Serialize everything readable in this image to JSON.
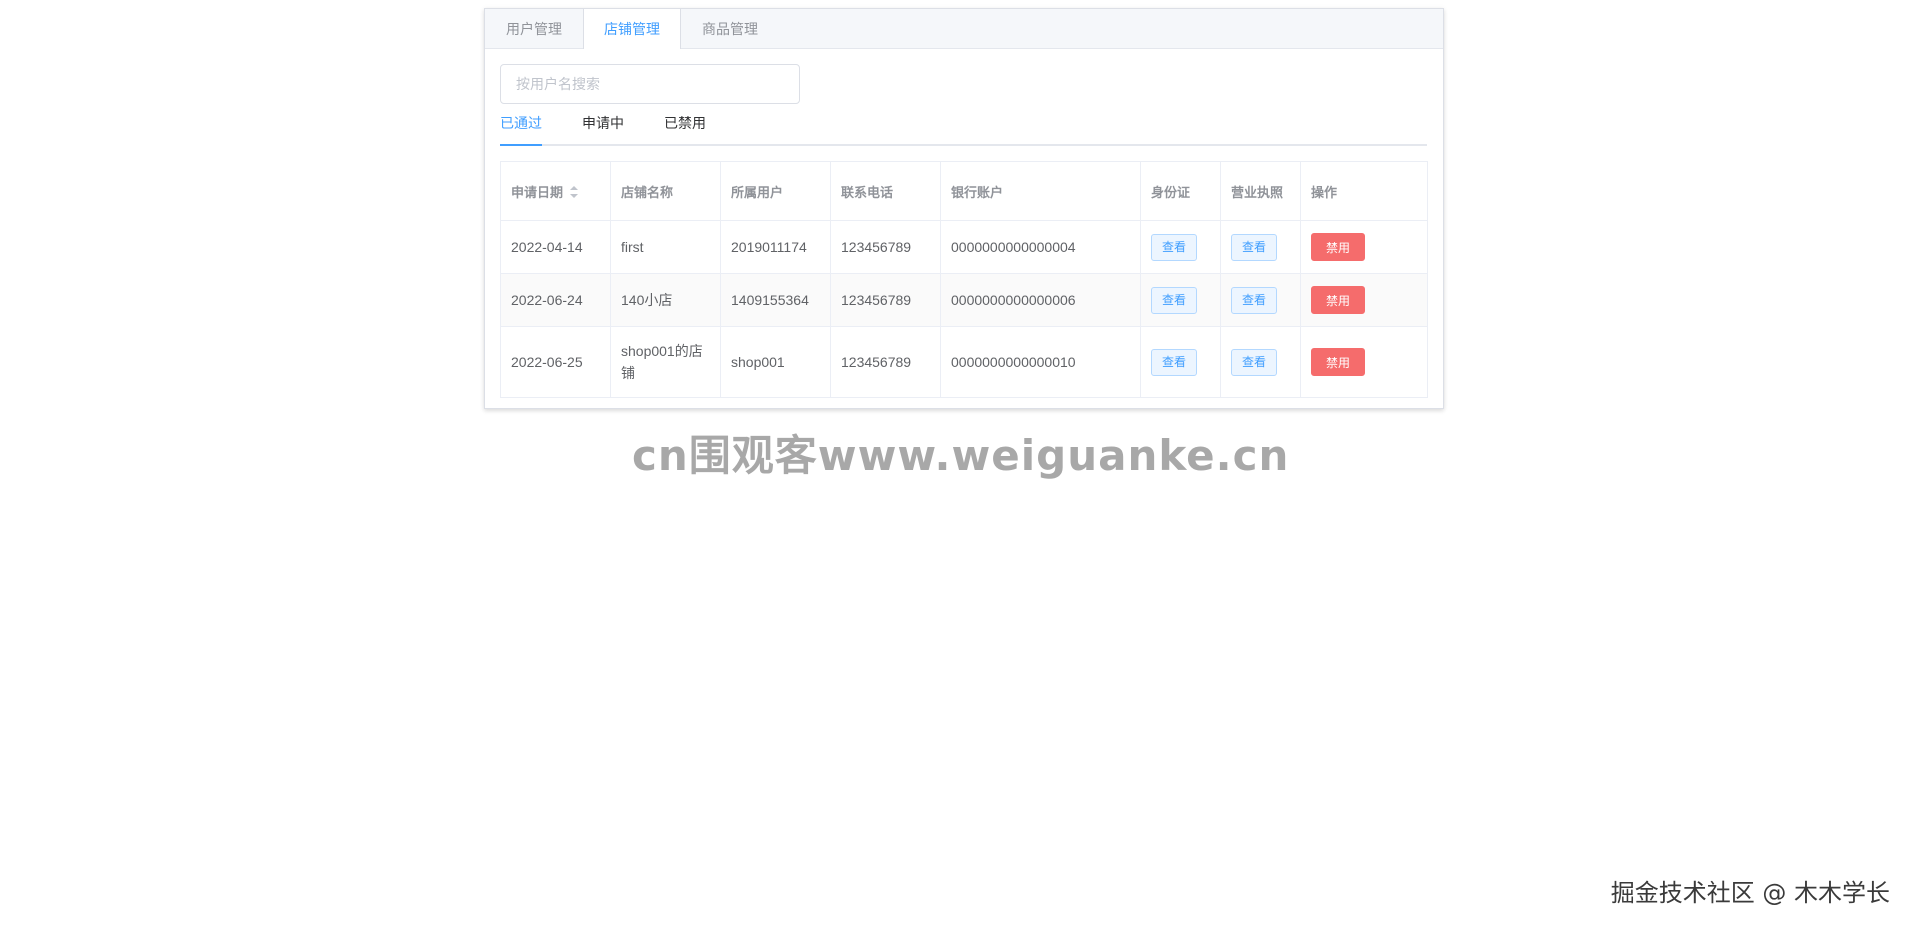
{
  "tabs": [
    {
      "label": "用户管理",
      "active": false
    },
    {
      "label": "店铺管理",
      "active": true
    },
    {
      "label": "商品管理",
      "active": false
    }
  ],
  "search": {
    "placeholder": "按用户名搜索",
    "value": ""
  },
  "status_tabs": [
    {
      "label": "已通过",
      "active": true
    },
    {
      "label": "申请中",
      "active": false
    },
    {
      "label": "已禁用",
      "active": false
    }
  ],
  "table": {
    "columns": [
      "申请日期",
      "店铺名称",
      "所属用户",
      "联系电话",
      "银行账户",
      "身份证",
      "营业执照",
      "操作"
    ],
    "rows": [
      {
        "date": "2022-04-14",
        "shop": "first",
        "user": "2019011174",
        "phone": "123456789",
        "bank": "0000000000000004",
        "id_btn": "查看",
        "license_btn": "查看",
        "action_btn": "禁用"
      },
      {
        "date": "2022-06-24",
        "shop": "140小店",
        "user": "1409155364",
        "phone": "123456789",
        "bank": "0000000000000006",
        "id_btn": "查看",
        "license_btn": "查看",
        "action_btn": "禁用"
      },
      {
        "date": "2022-06-25",
        "shop": "shop001的店铺",
        "user": "shop001",
        "phone": "123456789",
        "bank": "0000000000000010",
        "id_btn": "查看",
        "license_btn": "查看",
        "action_btn": "禁用"
      }
    ]
  },
  "watermarks": {
    "center": "cn围观客www.weiguanke.cn",
    "corner": "掘金技术社区 @ 木木学长"
  },
  "colors": {
    "accent": "#409eff",
    "danger": "#f56c6c",
    "watermark": "#a8a8a8"
  }
}
